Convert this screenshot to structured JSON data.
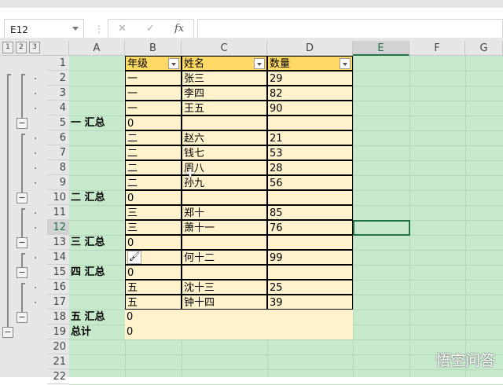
{
  "namebox": {
    "value": "E12"
  },
  "formula_bar": {
    "cancel": "✕",
    "enter": "✓",
    "fx": "fx",
    "value": ""
  },
  "outline_levels": [
    "1",
    "2",
    "3"
  ],
  "columns": [
    "A",
    "B",
    "C",
    "D",
    "E",
    "F",
    "G"
  ],
  "row_numbers": [
    "1",
    "2",
    "3",
    "4",
    "5",
    "6",
    "7",
    "8",
    "9",
    "10",
    "11",
    "12",
    "13",
    "14",
    "15",
    "16",
    "17",
    "18",
    "19",
    "20",
    "21",
    "22"
  ],
  "rows": [
    [
      "",
      "年级",
      "姓名",
      "数量"
    ],
    [
      "",
      "一",
      "张三",
      "29"
    ],
    [
      "",
      "一",
      "李四",
      "82"
    ],
    [
      "",
      "一",
      "王五",
      "90"
    ],
    [
      "一 汇总",
      "0",
      "",
      ""
    ],
    [
      "",
      "二",
      "赵六",
      "21"
    ],
    [
      "",
      "二",
      "钱七",
      "53"
    ],
    [
      "",
      "二",
      "周八",
      "28"
    ],
    [
      "",
      "二",
      "孙九",
      "56"
    ],
    [
      "二 汇总",
      "0",
      "",
      ""
    ],
    [
      "",
      "三",
      "郑十",
      "85"
    ],
    [
      "",
      "三",
      "萧十一",
      "76"
    ],
    [
      "三 汇总",
      "0",
      "",
      ""
    ],
    [
      "",
      "",
      "何十二",
      "99"
    ],
    [
      "四 汇总",
      "0",
      "",
      ""
    ],
    [
      "",
      "五",
      "沈十三",
      "25"
    ],
    [
      "",
      "五",
      "钟十四",
      "39"
    ],
    [
      "五 汇总",
      "0",
      "",
      ""
    ],
    [
      "总计",
      "0",
      "",
      ""
    ]
  ],
  "selected_cell": "E12",
  "colors": {
    "header_fill": "#ffd966",
    "data_fill": "#fff2cc",
    "sheet_fill": "#c6e9cc",
    "selection": "#217346"
  },
  "watermark": "悟空问答"
}
